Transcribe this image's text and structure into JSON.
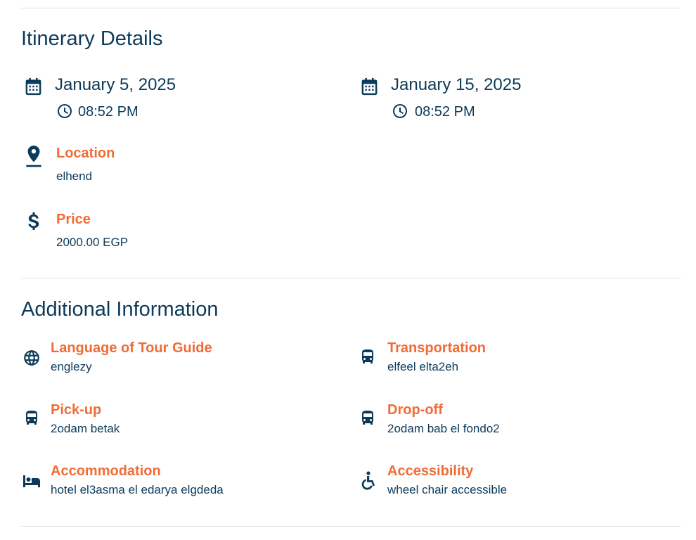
{
  "itinerary": {
    "title": "Itinerary Details",
    "start": {
      "date": "January 5, 2025",
      "time": "08:52 PM"
    },
    "end": {
      "date": "January 15, 2025",
      "time": "08:52 PM"
    },
    "location": {
      "label": "Location",
      "value": "elhend"
    },
    "price": {
      "label": "Price",
      "value": "2000.00 EGP"
    }
  },
  "additional": {
    "title": "Additional Information",
    "language": {
      "label": "Language of Tour Guide",
      "value": "englezy",
      "icon": "globe-icon"
    },
    "transportation": {
      "label": "Transportation",
      "value": "elfeel elta2eh",
      "icon": "bus-icon"
    },
    "pickup": {
      "label": "Pick-up",
      "value": "2odam betak",
      "icon": "bus-icon"
    },
    "dropoff": {
      "label": "Drop-off",
      "value": "2odam bab el fondo2",
      "icon": "bus-icon"
    },
    "accommodation": {
      "label": "Accommodation",
      "value": "hotel el3asma el edarya elgdeda",
      "icon": "bed-icon"
    },
    "accessibility": {
      "label": "Accessibility",
      "value": "wheel chair accessible",
      "icon": "wheelchair-icon"
    }
  },
  "colors": {
    "primary": "#0b3a5a",
    "accent": "#f06c36",
    "divider": "#e2e2e2"
  }
}
